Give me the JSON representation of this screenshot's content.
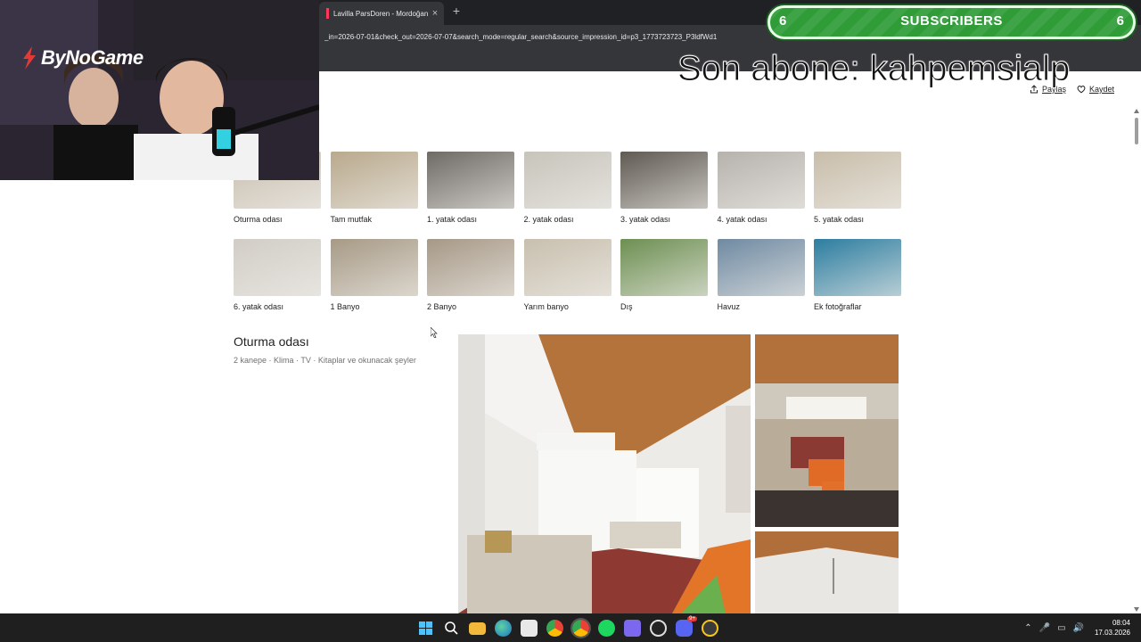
{
  "browser": {
    "tab_title": "Lavilla ParsDoren - Mordoğan",
    "tab_close": "×",
    "new_tab": "+",
    "url": "_in=2026-07-01&check_out=2026-07-07&search_mode=regular_search&source_impression_id=p3_1773723723_P3ldfWd1"
  },
  "actions": {
    "share": "Paylaş",
    "save": "Kaydet"
  },
  "gallery": {
    "items": [
      {
        "label": "Oturma odası",
        "color": "#c9bfb0"
      },
      {
        "label": "Tam mutfak",
        "color": "#b9a98d"
      },
      {
        "label": "1. yatak odası",
        "color": "#6e6a64"
      },
      {
        "label": "2. yatak odası",
        "color": "#c7c4bb"
      },
      {
        "label": "3. yatak odası",
        "color": "#5f5a52"
      },
      {
        "label": "4. yatak odası",
        "color": "#b6b2ac"
      },
      {
        "label": "5. yatak odası",
        "color": "#c8bdaa"
      },
      {
        "label": "6. yatak odası",
        "color": "#d1cdc6"
      },
      {
        "label": "1 Banyo",
        "color": "#a79a86"
      },
      {
        "label": "2 Banyo",
        "color": "#a69886"
      },
      {
        "label": "Yarım banyo",
        "color": "#c8bfae"
      },
      {
        "label": "Dış",
        "color": "#6d8f52"
      },
      {
        "label": "Havuz",
        "color": "#6f8aa2"
      },
      {
        "label": "Ek fotoğraflar",
        "color": "#2c7da0"
      }
    ]
  },
  "section": {
    "title": "Oturma odası",
    "amenities": "2 kanepe · Klima · TV · Kitaplar ve okunacak şeyler"
  },
  "overlay": {
    "brand": "ByNoGame",
    "subs_left": "6",
    "subs_label": "SUBSCRIBERS",
    "subs_right": "6",
    "last_sub": "Son abone: kahpemsialp"
  },
  "taskbar": {
    "icons": [
      "windows-start",
      "search",
      "file-explorer",
      "edge",
      "store",
      "chrome",
      "chrome-alt",
      "spotify",
      "app-purple",
      "obs",
      "discord",
      "app-yellow"
    ],
    "discord_badge": "9+",
    "time": "08:04",
    "date": "17.03.2026"
  }
}
